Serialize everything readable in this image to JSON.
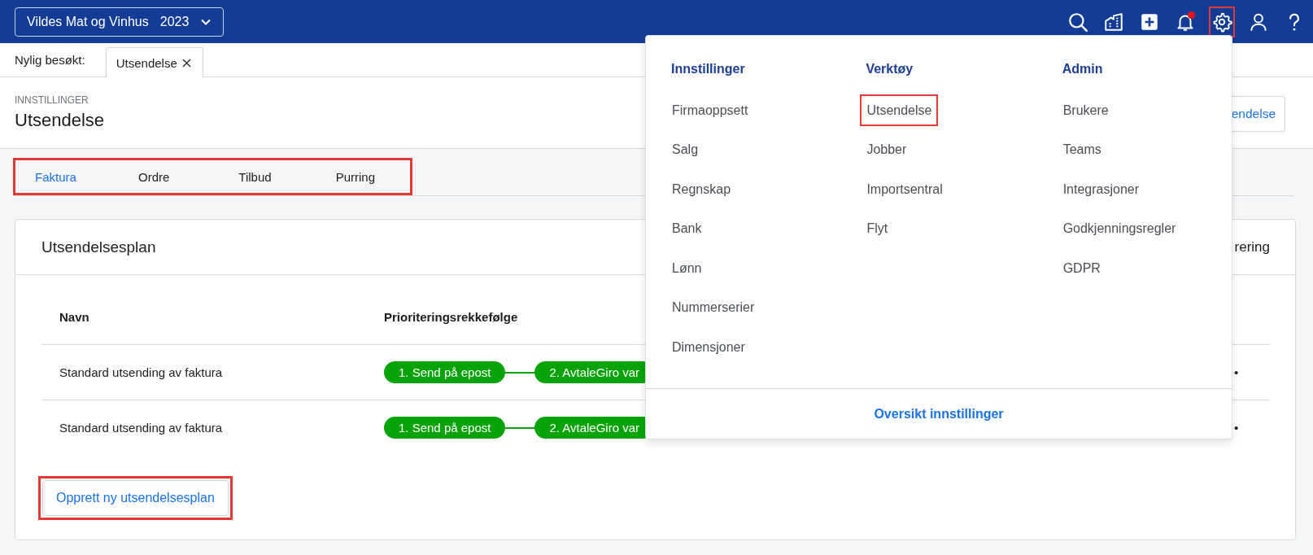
{
  "company_selector": {
    "name": "Vildes Mat og Vinhus",
    "year": "2023"
  },
  "top_icons": [
    {
      "kind": "search",
      "highlighted": false,
      "notification": false
    },
    {
      "kind": "building",
      "highlighted": false,
      "notification": false
    },
    {
      "kind": "plus",
      "highlighted": false,
      "notification": false
    },
    {
      "kind": "bell",
      "highlighted": false,
      "notification": true
    },
    {
      "kind": "gear",
      "highlighted": true,
      "notification": false
    },
    {
      "kind": "user",
      "highlighted": false,
      "notification": false
    },
    {
      "kind": "help",
      "highlighted": false,
      "notification": false
    }
  ],
  "recent": {
    "label": "Nylig besøkt:",
    "tabs": [
      {
        "label": "Utsendelse",
        "selected": true
      }
    ]
  },
  "page": {
    "breadcrumb": "INNSTILLINGER",
    "title": "Utsendelse",
    "action_button": "endelse"
  },
  "tabs": {
    "highlighted": true,
    "items": [
      {
        "label": "Faktura",
        "selected": true
      },
      {
        "label": "Ordre",
        "selected": false
      },
      {
        "label": "Tilbud",
        "selected": false
      },
      {
        "label": "Purring",
        "selected": false
      }
    ]
  },
  "card": {
    "title": "Utsendelsesplan",
    "header_action": "rering",
    "columns": [
      "Navn",
      "Prioriteringsrekkefølge"
    ],
    "rows": [
      {
        "name": "Standard utsending av faktura",
        "steps": [
          "1. Send på epost",
          "2. AvtaleGiro var"
        ],
        "menu": "•"
      },
      {
        "name": "Standard utsending av faktura",
        "steps": [
          "1. Send på epost",
          "2. AvtaleGiro var"
        ],
        "menu": "•"
      }
    ],
    "create_button": {
      "label": "Opprett ny utsendelsesplan",
      "highlighted": true
    }
  },
  "dropdown": {
    "columns": [
      {
        "heading": "Innstillinger",
        "items": [
          {
            "label": "Firmaoppsett",
            "highlighted": false
          },
          {
            "label": "Salg",
            "highlighted": false
          },
          {
            "label": "Regnskap",
            "highlighted": false
          },
          {
            "label": "Bank",
            "highlighted": false
          },
          {
            "label": "Lønn",
            "highlighted": false
          },
          {
            "label": "Nummerserier",
            "highlighted": false
          },
          {
            "label": "Dimensjoner",
            "highlighted": false
          }
        ]
      },
      {
        "heading": "Verktøy",
        "items": [
          {
            "label": "Utsendelse",
            "highlighted": true
          },
          {
            "label": "Jobber",
            "highlighted": false
          },
          {
            "label": "Importsentral",
            "highlighted": false
          },
          {
            "label": "Flyt",
            "highlighted": false
          }
        ]
      },
      {
        "heading": "Admin",
        "items": [
          {
            "label": "Brukere",
            "highlighted": false
          },
          {
            "label": "Teams",
            "highlighted": false
          },
          {
            "label": "Integrasjoner",
            "highlighted": false
          },
          {
            "label": "Godkjenningsregler",
            "highlighted": false
          },
          {
            "label": "GDPR",
            "highlighted": false
          }
        ]
      }
    ],
    "footer_link": "Oversikt innstillinger"
  }
}
